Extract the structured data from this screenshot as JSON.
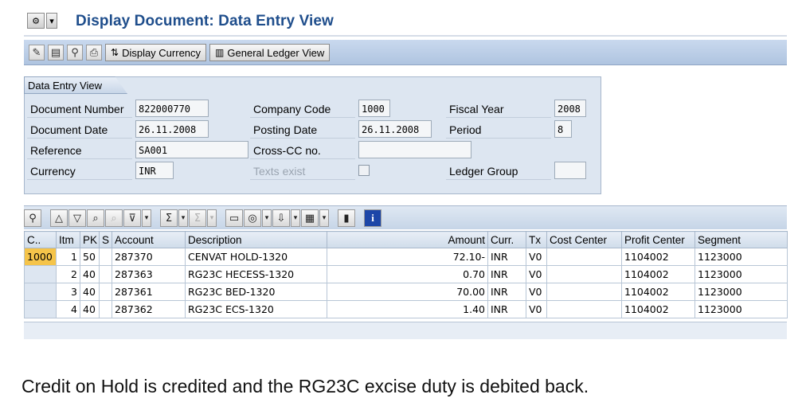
{
  "window": {
    "title": "Display Document: Data Entry View"
  },
  "toolbar": {
    "display_currency": "Display Currency",
    "general_ledger_view": "General Ledger View"
  },
  "header": {
    "tab": "Data Entry View",
    "fields": {
      "document_number_label": "Document Number",
      "document_number": "822000770",
      "company_code_label": "Company Code",
      "company_code": "1000",
      "fiscal_year_label": "Fiscal Year",
      "fiscal_year": "2008",
      "document_date_label": "Document Date",
      "document_date": "26.11.2008",
      "posting_date_label": "Posting Date",
      "posting_date": "26.11.2008",
      "period_label": "Period",
      "period": "8",
      "reference_label": "Reference",
      "reference": "SA001",
      "cross_cc_label": "Cross-CC no.",
      "cross_cc": "",
      "currency_label": "Currency",
      "currency": "INR",
      "texts_exist_label": "Texts exist",
      "ledger_group_label": "Ledger Group",
      "ledger_group": ""
    }
  },
  "grid": {
    "columns": {
      "c": "C..",
      "itm": "Itm",
      "pk": "PK",
      "s": "S",
      "account": "Account",
      "description": "Description",
      "amount": "Amount",
      "curr": "Curr.",
      "tx": "Tx",
      "cost_center": "Cost Center",
      "profit_center": "Profit Center",
      "segment": "Segment"
    },
    "rows": [
      {
        "c": "1000",
        "itm": "1",
        "pk": "50",
        "s": "",
        "account": "287370",
        "description": "CENVAT HOLD-1320",
        "amount": "72.10-",
        "curr": "INR",
        "tx": "V0",
        "cost_center": "",
        "profit_center": "1104002",
        "segment": "1123000"
      },
      {
        "c": "",
        "itm": "2",
        "pk": "40",
        "s": "",
        "account": "287363",
        "description": "RG23C HECESS-1320",
        "amount": "0.70",
        "curr": "INR",
        "tx": "V0",
        "cost_center": "",
        "profit_center": "1104002",
        "segment": "1123000"
      },
      {
        "c": "",
        "itm": "3",
        "pk": "40",
        "s": "",
        "account": "287361",
        "description": "RG23C BED-1320",
        "amount": "70.00",
        "curr": "INR",
        "tx": "V0",
        "cost_center": "",
        "profit_center": "1104002",
        "segment": "1123000"
      },
      {
        "c": "",
        "itm": "4",
        "pk": "40",
        "s": "",
        "account": "287362",
        "description": "RG23C ECS-1320",
        "amount": "1.40",
        "curr": "INR",
        "tx": "V0",
        "cost_center": "",
        "profit_center": "1104002",
        "segment": "1123000"
      }
    ]
  },
  "caption": "Credit on Hold is credited and the RG23C excise duty is debited back.",
  "colors": {
    "title": "#1f4e8c",
    "toolbar": "#afc4e0",
    "panel": "#dde6f1",
    "highlight": "#f5c44a"
  },
  "icons": {
    "window_menu": "window-menu-icon",
    "toolbar": [
      "edit-icon",
      "document-icon",
      "find-icon",
      "print-icon"
    ],
    "grid_toolbar": [
      "details-icon",
      "print-icon",
      "filter-icon",
      "find-icon",
      "sort-icon",
      "sum-icon",
      "subtotal-icon",
      "layout-icon",
      "export-icon",
      "graphic-icon",
      "info-icon"
    ]
  }
}
